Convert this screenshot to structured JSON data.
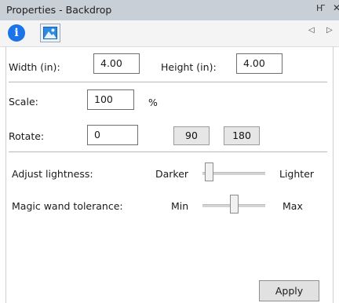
{
  "window": {
    "title": "Properties - Backdrop",
    "pin_icon": "pin-icon",
    "close_icon": "close-icon"
  },
  "tabs": [
    {
      "name": "info",
      "icon": "info-icon",
      "glyph": "i",
      "active": true
    },
    {
      "name": "image",
      "icon": "image-icon",
      "active": false
    }
  ],
  "tab_nav": {
    "prev": "◁",
    "next": "▷"
  },
  "size": {
    "width_label": "Width (in):",
    "width_value": "4.00",
    "height_label": "Height (in):",
    "height_value": "4.00"
  },
  "scale": {
    "label": "Scale:",
    "value": "100",
    "unit": "%"
  },
  "rotate": {
    "label": "Rotate:",
    "value": "0",
    "btn_90": "90",
    "btn_180": "180"
  },
  "lightness": {
    "label": "Adjust lightness:",
    "min_label": "Darker",
    "max_label": "Lighter",
    "level": 0.05
  },
  "wand": {
    "label": "Magic wand tolerance:",
    "min_label": "Min",
    "max_label": "Max",
    "level": 0.5
  },
  "actions": {
    "apply": "Apply"
  },
  "colors": {
    "accent": "#1a73e8",
    "titlebar": "#c9cfd6"
  }
}
